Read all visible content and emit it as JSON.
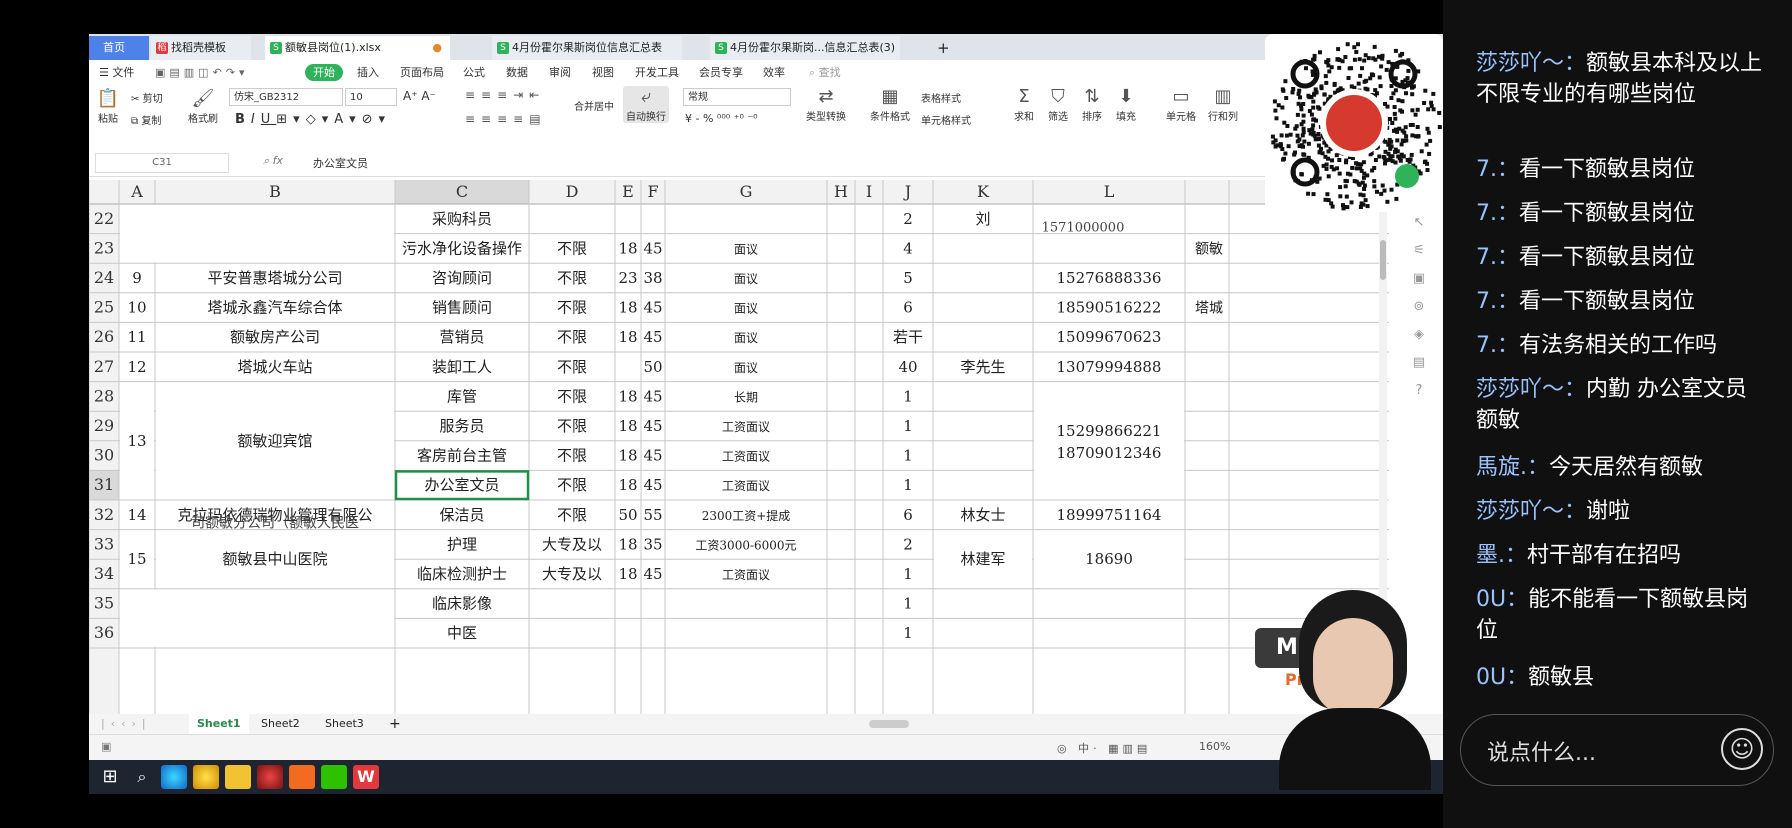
{
  "tabs": [
    {
      "label": "首页"
    },
    {
      "label": "找稻壳模板",
      "icon": "daoke-icon"
    },
    {
      "label": "额敏县岗位(1).xlsx",
      "icon": "spreadsheet-icon"
    },
    {
      "label": "4月份霍尔果斯岗位信息汇总表",
      "icon": "spreadsheet-icon"
    },
    {
      "label": "4月份霍尔果斯岗...信息汇总表(3)",
      "icon": "spreadsheet-icon"
    },
    {
      "label": "+"
    }
  ],
  "menu": {
    "file": "文件",
    "items": [
      "开始",
      "插入",
      "页面布局",
      "公式",
      "数据",
      "审阅",
      "视图",
      "开发工具",
      "会员专享",
      "效率"
    ],
    "search": "查找"
  },
  "ribbon": {
    "paste": "粘贴",
    "cut": "剪切",
    "copy": "复制",
    "format_painter": "格式刷",
    "font": "仿宋_GB2312",
    "size": "10",
    "merge": "合并居中",
    "wrap": "自动换行",
    "number_format": "常规",
    "type_convert": "类型转换",
    "cond_format": "条件格式",
    "table_style": "表格样式",
    "cell_style": "单元格样式",
    "sum": "求和",
    "filter": "筛选",
    "sort": "排序",
    "fill": "填充",
    "cell": "单元格",
    "rowcol": "行和列"
  },
  "formula": {
    "cell_ref": "C31",
    "fx": "fx",
    "value": "办公室文员"
  },
  "columns": [
    "A",
    "B",
    "C",
    "D",
    "E",
    "F",
    "G",
    "H",
    "I",
    "J",
    "K",
    "L"
  ],
  "rows": [
    {
      "n": "22",
      "a": "",
      "b": "",
      "c": "采购科员",
      "d": "",
      "e": "",
      "f": "",
      "g": "",
      "j": "2",
      "k": "刘",
      "l": ""
    },
    {
      "n": "23",
      "a": "",
      "b": "",
      "c": "污水净化设备操作",
      "d": "不限",
      "e": "18",
      "f": "45",
      "g": "面议",
      "j": "4",
      "k": "",
      "l": ""
    },
    {
      "n": "24",
      "a": "9",
      "b": "平安普惠塔城分公司",
      "c": "咨询顾问",
      "d": "不限",
      "e": "23",
      "f": "38",
      "g": "面议",
      "j": "5",
      "k": "",
      "l": "15276888336"
    },
    {
      "n": "25",
      "a": "10",
      "b": "塔城永鑫汽车综合体",
      "c": "销售顾问",
      "d": "不限",
      "e": "18",
      "f": "45",
      "g": "面议",
      "j": "6",
      "k": "",
      "l": "18590516222"
    },
    {
      "n": "26",
      "a": "11",
      "b": "额敏房产公司",
      "c": "营销员",
      "d": "不限",
      "e": "18",
      "f": "45",
      "g": "面议",
      "j": "若干",
      "k": "",
      "l": "15099670623"
    },
    {
      "n": "27",
      "a": "12",
      "b": "塔城火车站",
      "c": "装卸工人",
      "d": "不限",
      "e": "",
      "f": "50",
      "g": "面议",
      "j": "40",
      "k": "李先生",
      "l": "13079994888"
    },
    {
      "n": "28",
      "a": "",
      "b": "",
      "c": "库管",
      "d": "不限",
      "e": "18",
      "f": "45",
      "g": "长期",
      "j": "1",
      "k": "",
      "l": ""
    },
    {
      "n": "29",
      "a": "",
      "b": "",
      "c": "服务员",
      "d": "不限",
      "e": "18",
      "f": "45",
      "g": "工资面议",
      "j": "1",
      "k": "",
      "l": ""
    },
    {
      "n": "30",
      "a": "",
      "b": "",
      "c": "客房前台主管",
      "d": "不限",
      "e": "18",
      "f": "45",
      "g": "工资面议",
      "j": "1",
      "k": "",
      "l": ""
    },
    {
      "n": "31",
      "a": "",
      "b": "",
      "c": "办公室文员",
      "d": "不限",
      "e": "18",
      "f": "45",
      "g": "工资面议",
      "j": "1",
      "k": "",
      "l": ""
    },
    {
      "n": "32",
      "a": "14",
      "b": "克拉玛依德瑞物业管理有限公",
      "c": "保洁员",
      "d": "不限",
      "e": "50",
      "f": "55",
      "g": "2300工资+提成",
      "j": "6",
      "k": "林女士",
      "l": "18999751164"
    },
    {
      "n": "33",
      "a": "",
      "b": "",
      "c": "护理",
      "d": "大专及以",
      "e": "18",
      "f": "35",
      "g": "工资3000-6000元",
      "j": "2",
      "k": "",
      "l": ""
    },
    {
      "n": "34",
      "a": "",
      "b": "",
      "c": "临床检测护士",
      "d": "大专及以",
      "e": "18",
      "f": "45",
      "g": "工资面议",
      "j": "1",
      "k": "",
      "l": ""
    },
    {
      "n": "35",
      "a": "",
      "b": "",
      "c": "临床影像",
      "d": "",
      "e": "",
      "f": "",
      "g": "",
      "j": "1",
      "k": "",
      "l": ""
    },
    {
      "n": "36",
      "a": "",
      "b": "",
      "c": "中医",
      "d": "",
      "e": "",
      "f": "",
      "g": "",
      "j": "1",
      "k": "",
      "l": ""
    }
  ],
  "merged": {
    "r13_a": "13",
    "r13_b": "额敏迎宾馆",
    "r13_l1": "15299866221",
    "r13_l2": "18709012346",
    "r15_a": "15",
    "r15_b": "额敏县中山医院",
    "r15_k": "林建军",
    "r15_l": "18690",
    "overflow_k22": "1571000000",
    "overflow_m23": "额敏",
    "overflow_m25": "塔城",
    "overflow_b32": "司额敏分公司（额敏人民医"
  },
  "sheets": [
    "Sheet1",
    "Sheet2",
    "Sheet3"
  ],
  "status": {
    "zoom": "160%"
  },
  "chat": {
    "messages": [
      {
        "name": "莎莎吖～：",
        "text": "额敏县本科及以上 不限专业的有哪些岗位"
      },
      {
        "name": "7.：",
        "text": "看一下额敏县岗位"
      },
      {
        "name": "7.：",
        "text": "看一下额敏县岗位"
      },
      {
        "name": "7.：",
        "text": "看一下额敏县岗位"
      },
      {
        "name": "7.：",
        "text": "看一下额敏县岗位"
      },
      {
        "name": "7.：",
        "text": "有法务相关的工作吗"
      },
      {
        "name": "莎莎吖～：",
        "text": "内勤 办公室文员 额敏"
      },
      {
        "name": "馬旋.：",
        "text": "今天居然有额敏"
      },
      {
        "name": "莎莎吖～：",
        "text": "谢啦"
      },
      {
        "name": "墨.：",
        "text": "村干部有在招吗"
      },
      {
        "name": "0U：",
        "text": "能不能看一下额敏县岗位"
      },
      {
        "name": "0U：",
        "text": "额敏县"
      }
    ],
    "placeholder": "说点什么...",
    "overlay": {
      "badge": "M",
      "brand": "Pro"
    }
  },
  "colors": {
    "accent_green": "#2fb35a",
    "home_tab": "#4e82e8",
    "name_blue": "#9ac2ff",
    "selected_cell": "#1f8f4a"
  }
}
